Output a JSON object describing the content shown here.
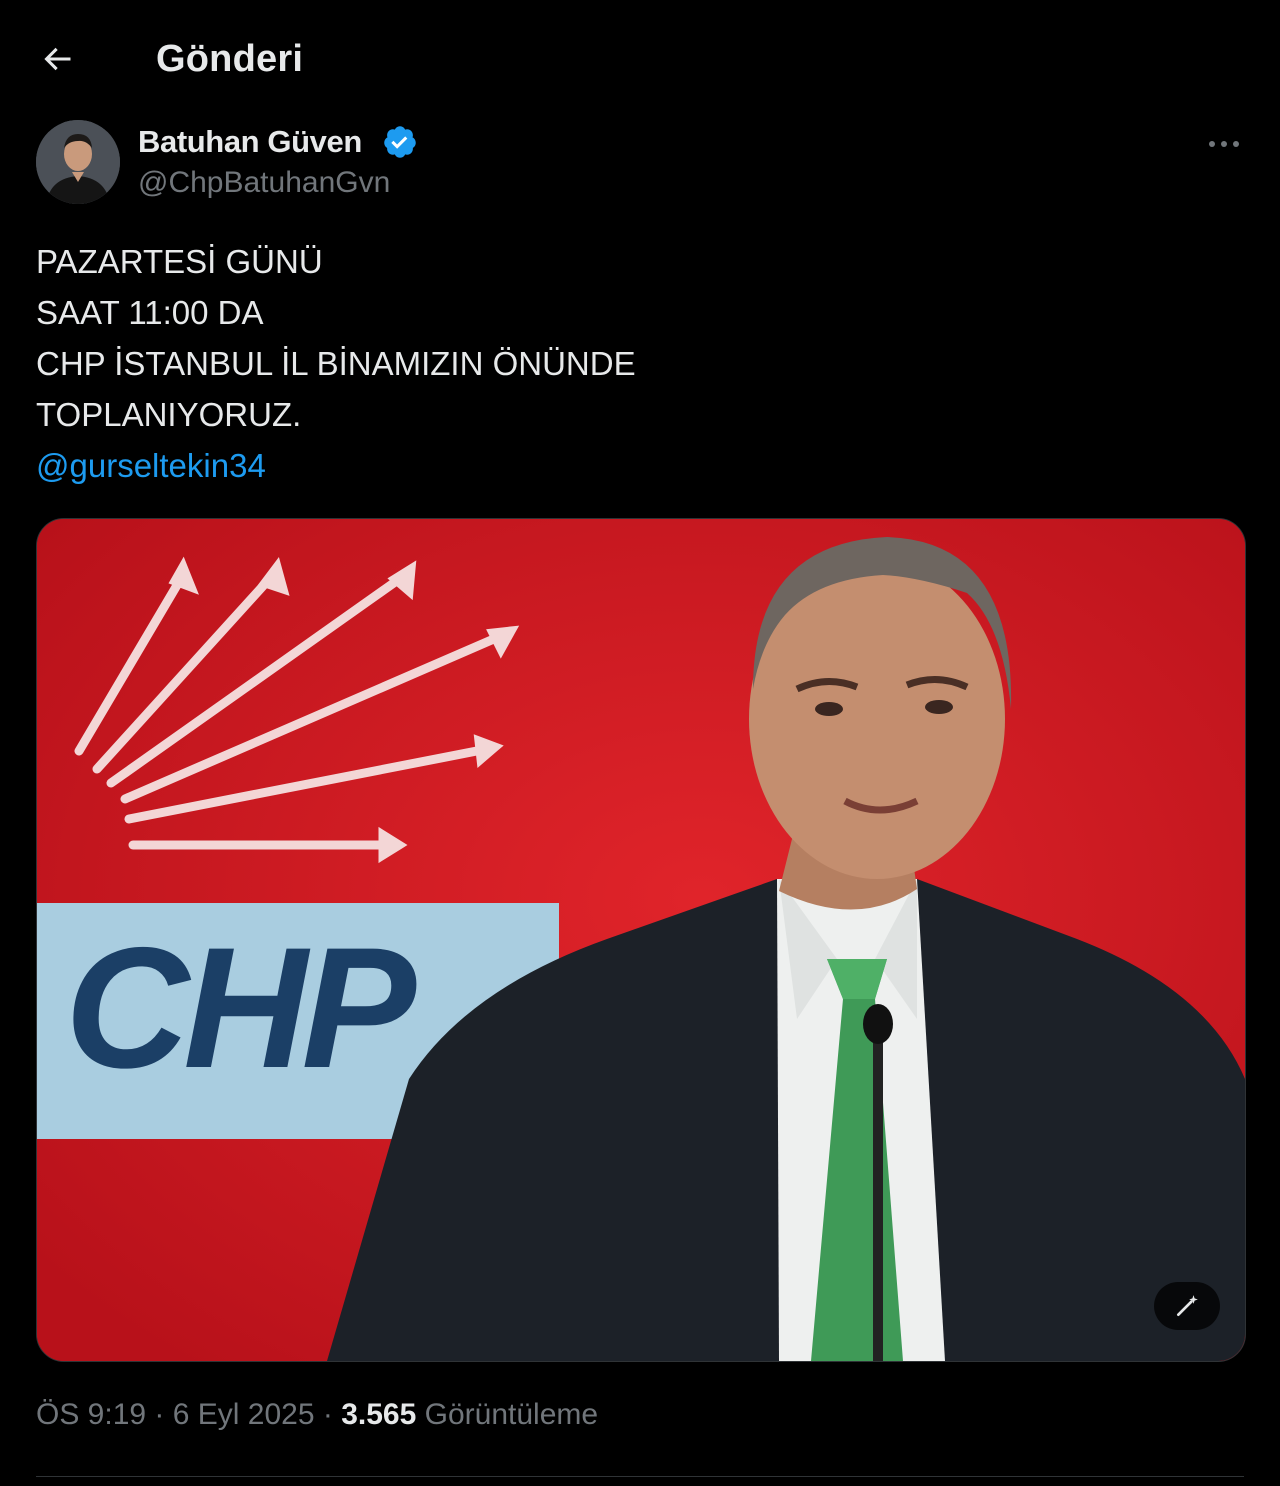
{
  "header": {
    "back_icon": "arrow-left-icon",
    "title": "Gönderi"
  },
  "author": {
    "name": "Batuhan Güven",
    "handle": "@ChpBatuhanGvn",
    "verified_icon": "verified-badge-icon",
    "verified_color": "#1d9bf0",
    "more_icon": "more-horizontal-icon"
  },
  "tweet": {
    "lines": [
      "PAZARTESİ GÜNÜ",
      "SAAT 11:00 DA",
      "CHP İSTANBUL İL BİNAMIZIN ÖNÜNDE",
      "TOPLANIYORUZ."
    ],
    "mention": "@gurseltekin34"
  },
  "media": {
    "logo_text": "CHP",
    "background_color": "#c8141a",
    "logo_color": "#1b3f66",
    "alt_icon": "magic-wand-icon"
  },
  "meta": {
    "time": "ÖS 9:19",
    "separator": " · ",
    "date": "6 Eyl 2025",
    "views_count": "3.565",
    "views_label": "Görüntüleme"
  },
  "colors": {
    "background": "#000000",
    "text_primary": "#e7e9ea",
    "text_secondary": "#71767b",
    "link": "#1d9bf0"
  }
}
